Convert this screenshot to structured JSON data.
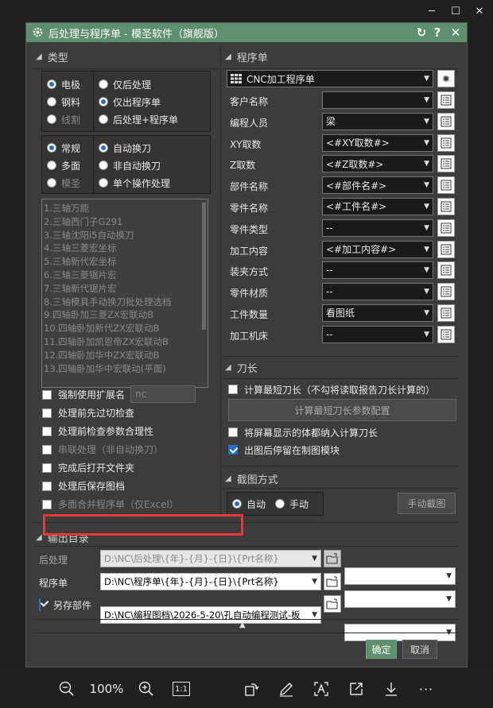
{
  "window": {
    "minimize": "─",
    "maximize": "☐",
    "close": "✕"
  },
  "dialog": {
    "title": "后处理与程序单 - 模圣软件（旗舰版）",
    "refresh": "↻",
    "help": "?",
    "close": "✕"
  },
  "type_section": {
    "title": "类型",
    "group1_left": [
      {
        "label": "电极",
        "checked": true
      },
      {
        "label": "钢料",
        "checked": false
      },
      {
        "label": "线割",
        "checked": false,
        "dim": true
      }
    ],
    "group1_right": [
      {
        "label": "仅后处理",
        "checked": false
      },
      {
        "label": "仅出程序单",
        "checked": true
      },
      {
        "label": "后处理+程序单",
        "checked": false
      }
    ],
    "group2_left": [
      {
        "label": "常规",
        "checked": true
      },
      {
        "label": "多面",
        "checked": false
      },
      {
        "label": "模圣",
        "checked": false,
        "dim": true
      }
    ],
    "group2_right": [
      {
        "label": "自动换刀",
        "checked": true
      },
      {
        "label": "非自动换刀",
        "checked": false
      },
      {
        "label": "单个操作处理",
        "checked": false
      }
    ],
    "machines": [
      "1.三轴万能",
      "2.三轴西门子G291",
      "3.三轴沈阳i5自动换刀",
      "4.三轴三菱宏坐标",
      "5.三轴新代宏坐标",
      "6.三轴三菱锯片宏",
      "7.三轴新代锯片宏",
      "8.三轴模具手动换刀批处理选档",
      "9.四轴卧加三菱ZX宏联动B",
      "10.四轴卧加新代ZX宏联动B",
      "11.四轴卧加凯恩帝ZX宏联动B",
      "12.四轴卧加华中ZX宏联动B",
      "13.四轴卧加华中宏联动(平面)"
    ],
    "options": [
      {
        "label": "强制使用扩展名",
        "checked": false,
        "dim": false,
        "ext": "nc"
      },
      {
        "label": "处理前先过切检查",
        "checked": false
      },
      {
        "label": "处理前检查参数合理性",
        "checked": false
      },
      {
        "label": "串联处理（非自动换刀）",
        "checked": false,
        "dim": true
      },
      {
        "label": "完成后打开文件夹",
        "checked": false
      },
      {
        "label": "处理后保存图档",
        "checked": false
      },
      {
        "label": "多面合并程序单（仅Excel）",
        "checked": false,
        "dim": true
      }
    ]
  },
  "program_section": {
    "title": "程序单",
    "template": "CNC加工程序单",
    "fields": [
      {
        "label": "客户名称",
        "value": ""
      },
      {
        "label": "编程人员",
        "value": "梁"
      },
      {
        "label": "XY取数",
        "value": "<#XY取数#>"
      },
      {
        "label": "Z取数",
        "value": "<#Z取数#>"
      },
      {
        "label": "部件名称",
        "value": "<#部件名#>"
      },
      {
        "label": "零件名称",
        "value": "<#工件名#>"
      },
      {
        "label": "零件类型",
        "value": "--"
      },
      {
        "label": "加工内容",
        "value": "<#加工内容#>"
      },
      {
        "label": "装夹方式",
        "value": "--"
      },
      {
        "label": "零件材质",
        "value": "--"
      },
      {
        "label": "工件数量",
        "value": "看图纸"
      },
      {
        "label": "加工机床",
        "value": "--"
      }
    ]
  },
  "tool_section": {
    "title": "刀长",
    "calc_label": "计算最短刀长（不勾将读取报告刀长计算的）",
    "config_button": "计算最短刀长参数配置",
    "include_body": "将屏幕显示的体都纳入计算刀长",
    "stay_in_drawing": "出图后停留在制图模块"
  },
  "capture_section": {
    "title": "截图方式",
    "auto": "自动",
    "manual": "手动",
    "manual_button": "手动截图"
  },
  "output_section": {
    "title": "输出目录",
    "rows": [
      {
        "label": "后处理",
        "path": "D:\\NC\\后处理\\{年}-{月}-{日}\\{Prt名称}",
        "disabled": true
      },
      {
        "label": "程序单",
        "path": "D:\\NC\\程序单\\{年}-{月}-{日}\\{Prt名称}",
        "disabled": false
      },
      {
        "label": "另存部件",
        "path": "D:\\NC\\编程图档\\2026-5-20\\孔自动编程测试-板",
        "disabled": false,
        "checked": true
      }
    ]
  },
  "buttons": {
    "ok": "确定",
    "cancel": "取消",
    "collapse": "▲"
  },
  "viewer": {
    "zoom": "100%",
    "zoom_out": "−",
    "zoom_in": "+",
    "actual": "1:1",
    "more": "···"
  },
  "colors": {
    "accent": "#5e8f6e",
    "highlight_box": "#e53935",
    "radio_on": "#1f6fd1"
  }
}
